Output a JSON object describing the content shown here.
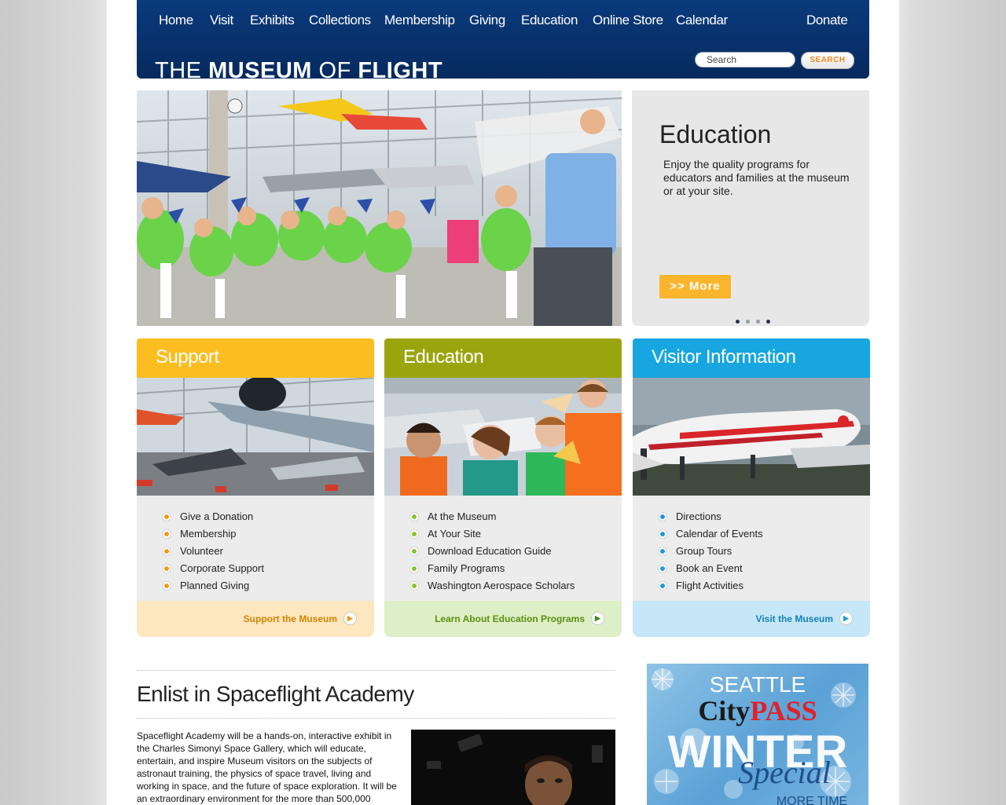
{
  "nav": {
    "items": [
      "Home",
      "Visit",
      "Exhibits",
      "Collections",
      "Membership",
      "Giving",
      "Education",
      "Online Store",
      "Calendar"
    ],
    "donate": "Donate"
  },
  "brand": {
    "logo_light_1": "THE ",
    "logo_bold_1": "MUSEUM",
    "logo_light_2": " OF ",
    "logo_bold_2": "FLIGHT"
  },
  "search": {
    "placeholder": "Search",
    "button": "SEARCH"
  },
  "hero": {
    "title": "Education",
    "text": "Enjoy the quality programs for educators and families at the museum or at your site.",
    "button": ">> More",
    "slide_count": 4,
    "active_slide": 4
  },
  "columns": [
    {
      "title": "Support",
      "color": "#fbbd1f",
      "dot": "#f39a17",
      "footer_bg": "#fde7bf",
      "footer_color": "#d08300",
      "items": [
        "Give a Donation",
        "Membership",
        "Volunteer",
        "Corporate Support",
        "Planned Giving"
      ],
      "footer": "Support the Museum"
    },
    {
      "title": "Education",
      "color": "#9aa50d",
      "dot": "#8ac22f",
      "footer_bg": "#dcefc6",
      "footer_color": "#5e8e10",
      "items": [
        "At the Museum",
        "At Your Site",
        "Download Education Guide",
        "Family Programs",
        "Washington Aerospace Scholars"
      ],
      "footer": "Learn About Education Programs"
    },
    {
      "title": "Visitor Information",
      "color": "#17a6e0",
      "dot": "#1f9ad6",
      "footer_bg": "#c5e7f7",
      "footer_color": "#1580b8",
      "items": [
        "Directions",
        "Calendar of Events",
        "Group Tours",
        "Book an Event",
        "Flight Activities"
      ],
      "footer": "Visit the Museum"
    }
  ],
  "article": {
    "title": "Enlist in Spaceflight Academy",
    "text": "Spaceflight Academy will be a hands-on, interactive exhibit in the Charles Simonyi Space Gallery, which will educate, entertain, and inspire Museum visitors on the subjects of astronaut training, the physics of space travel, living and working in space, and the future of space exploration. It will be an extraordinary environment for the more than 500,000"
  },
  "ad": {
    "line1": "SEATTLE",
    "city": "City",
    "pass": "PASS",
    "winter": "WINTER",
    "special": "Special",
    "more": "MORE TIME"
  }
}
